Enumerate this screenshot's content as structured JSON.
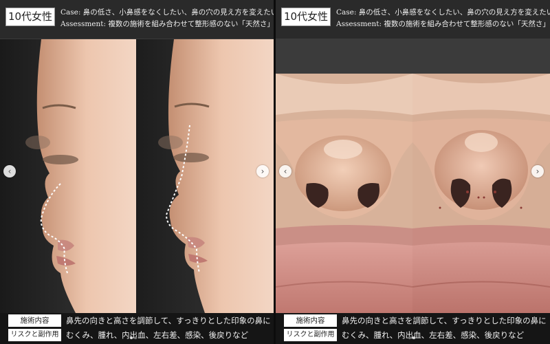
{
  "slides": [
    {
      "id": "left",
      "badge": "10代女性",
      "case": "Case: 鼻の低さ、小鼻感をなくしたい、鼻の穴の見え方を変えたい",
      "assessment": "Assessment: 複数の施術を組み合わせて整形感のない「天然さ」を実現",
      "treatment_label": "施術内容",
      "treatment_text": "鼻先の向きと高さを調節して、すっきりとした印象の鼻に",
      "risk_label": "リスクと副作用",
      "risk_text": "むくみ、腫れ、内出血、左右差、感染、後戻りなど",
      "photo_before": "side-profile-before",
      "photo_after": "side-profile-after"
    },
    {
      "id": "right",
      "badge": "10代女性",
      "case": "Case: 鼻の低さ、小鼻感をなくしたい、鼻の穴の見え方を変えたい",
      "assessment": "Assessment: 複数の施術を組み合わせて整形感のない「天然さ」を実現",
      "treatment_label": "施術内容",
      "treatment_text": "鼻先の向きと高さを調節して、すっきりとした印象の鼻に",
      "risk_label": "リスクと副作用",
      "risk_text": "むくみ、腫れ、内出血、左右差、感染、後戻りなど",
      "photo_before": "nostril-view-before",
      "photo_after": "nostril-view-after"
    }
  ],
  "nav": {
    "prev_icon": "chevron-left-icon",
    "next_icon": "chevron-right-icon",
    "prev_glyph": "‹",
    "next_glyph": "›"
  },
  "colors": {
    "skin": "#e8b9a0",
    "background": "#202020",
    "badge_bg": "#ffffff"
  }
}
